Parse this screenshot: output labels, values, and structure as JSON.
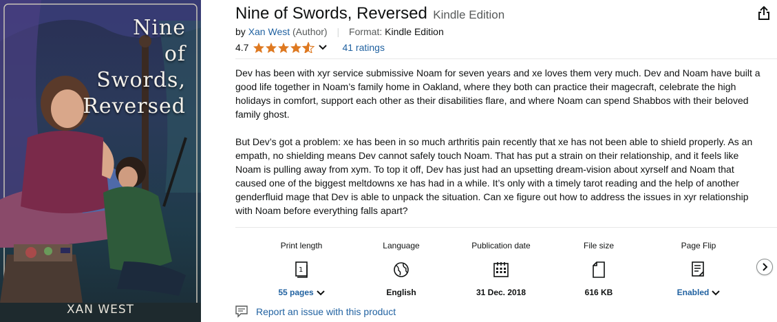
{
  "book": {
    "title": "Nine of Swords, Reversed",
    "edition": "Kindle Edition",
    "by_prefix": "by",
    "author": "Xan West",
    "author_role": "(Author)",
    "format_label": "Format:",
    "format_value": "Kindle Edition"
  },
  "rating": {
    "value": "4.7",
    "stars": 4.7,
    "count_label": "41 ratings",
    "star_color": "#de7921"
  },
  "cover": {
    "title_lines": [
      "Nine",
      "of",
      "Swords,",
      "Reversed"
    ],
    "author": "XAN WEST"
  },
  "description": {
    "p1": "Dev has been with xyr service submissive Noam for seven years and xe loves them very much. Dev and Noam have built a good life together in Noam’s family home in Oakland, where they both can practice their magecraft, celebrate the high holidays in comfort, support each other as their disabilities flare, and where Noam can spend Shabbos with their beloved family ghost.",
    "p2": "But Dev’s got a problem: xe has been in so much arthritis pain recently that xe has not been able to shield properly. As an empath, no shielding means Dev cannot safely touch Noam. That has put a strain on their relationship, and it feels like Noam is pulling away from xym. To top it off, Dev has just had an upsetting dream-vision about xyrself and Noam that caused one of the biggest meltdowns xe has had in a while. It’s only with a timely tarot reading and the help of another genderfluid mage that Dev is able to unpack the situation. Can xe figure out how to address the issues in xyr relationship with Noam before everything falls apart?"
  },
  "attributes": [
    {
      "label": "Print length",
      "icon": "book-pages-icon",
      "value": "55 pages"
    },
    {
      "label": "Language",
      "icon": "globe-icon",
      "value": "English"
    },
    {
      "label": "Publication date",
      "icon": "calendar-icon",
      "value": "31 Dec. 2018"
    },
    {
      "label": "File size",
      "icon": "file-icon",
      "value": "616 KB"
    },
    {
      "label": "Page Flip",
      "icon": "page-flip-icon",
      "value": "Enabled"
    }
  ],
  "report_label": "Report an issue with this product",
  "colors": {
    "link": "#2162a1",
    "text": "#0f1111",
    "muted": "#565959"
  }
}
